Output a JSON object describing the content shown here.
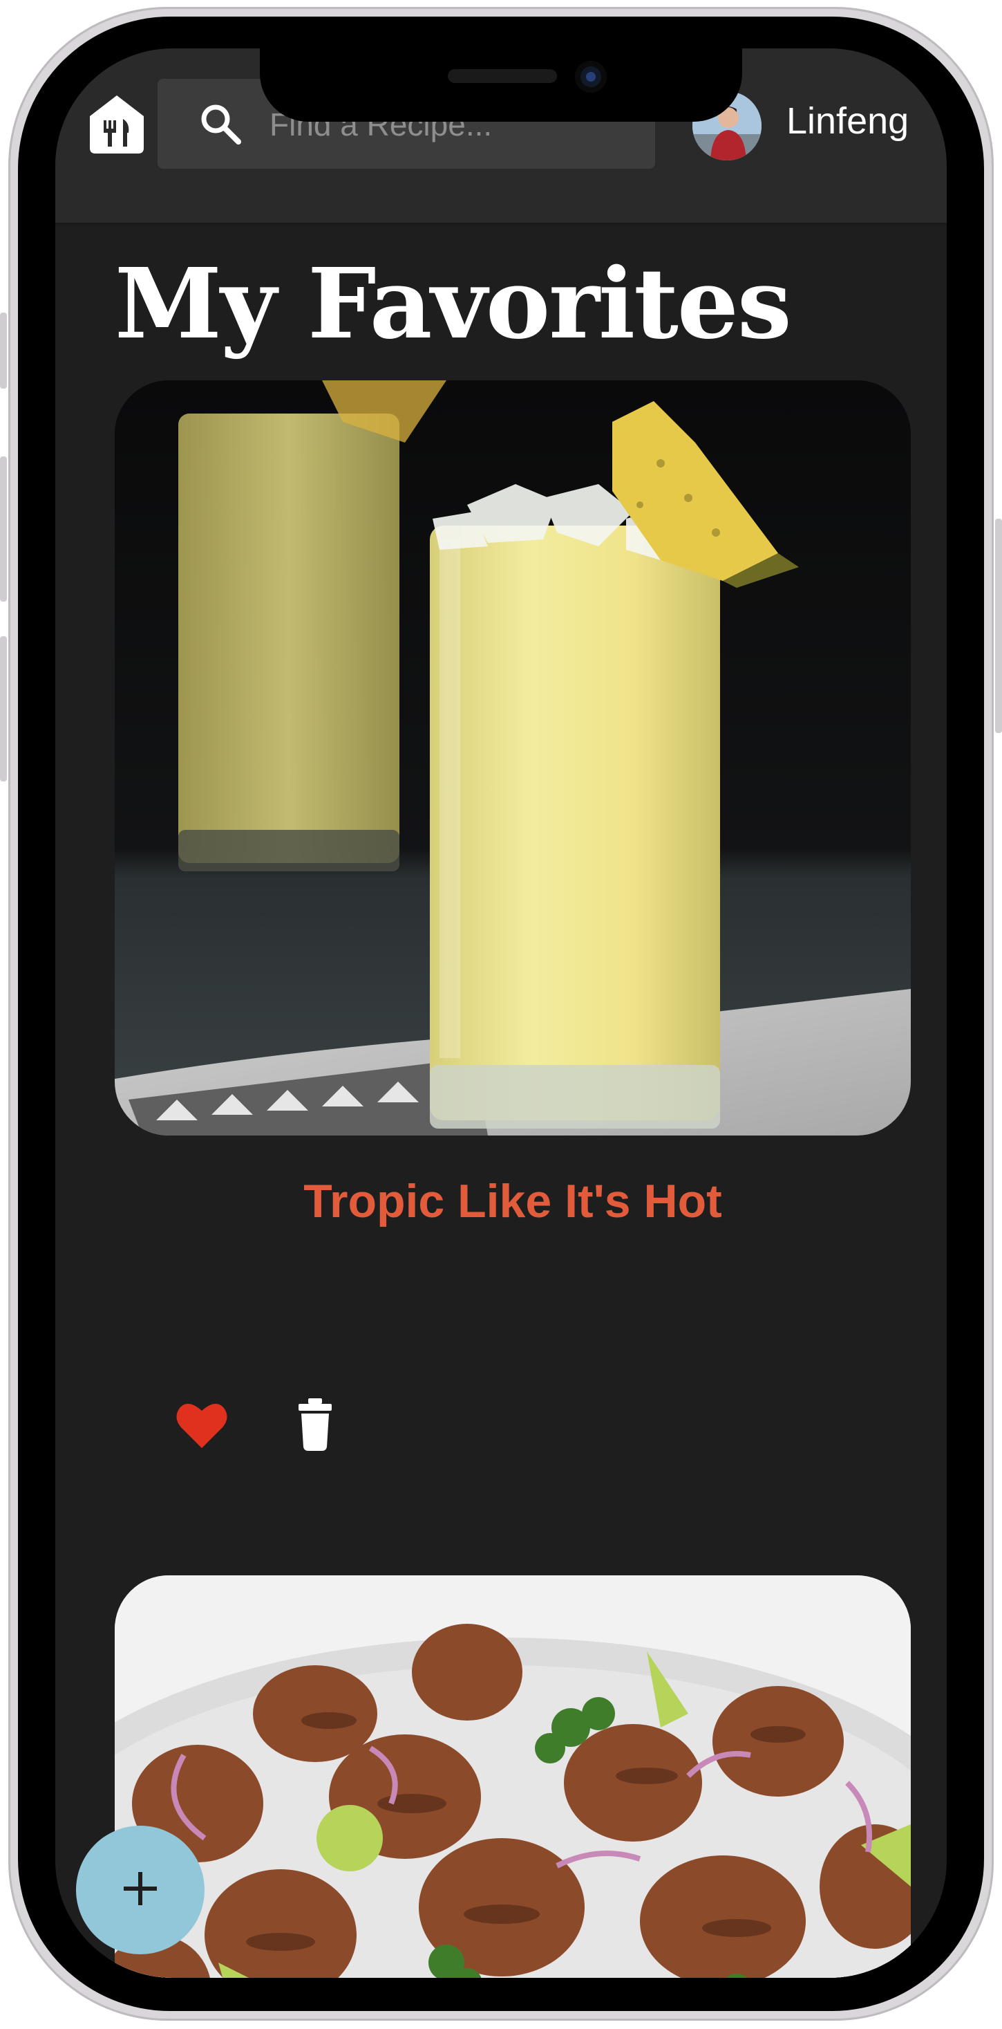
{
  "header": {
    "home_icon": "restaurant-home-icon",
    "search": {
      "icon": "search-icon",
      "placeholder": "Find a Recipe..."
    },
    "user": {
      "name": "Linfeng",
      "avatar": "user-avatar"
    }
  },
  "main": {
    "title": "My Favorites",
    "recipes": [
      {
        "title": "Tropic Like It's Hot",
        "image": "pineapple-cocktail-photo",
        "favorite_icon": "heart-icon",
        "delete_icon": "trash-icon"
      },
      {
        "image": "grilled-chicken-photo"
      }
    ]
  },
  "fab": {
    "icon": "plus-icon"
  },
  "colors": {
    "background": "#1e1e1f",
    "appbar": "#2a2a2b",
    "accent_title": "#e25c3b",
    "heart": "#e0301e",
    "fab": "#91c7d9"
  }
}
